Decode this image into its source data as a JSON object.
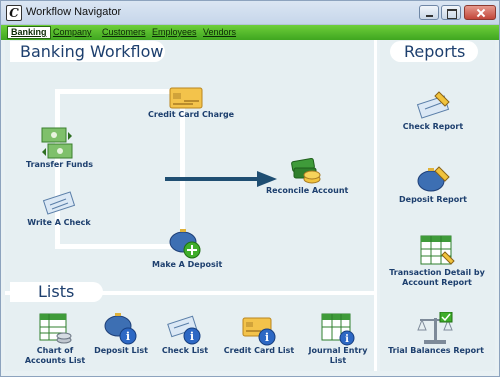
{
  "window": {
    "title": "Workflow Navigator"
  },
  "menu": [
    {
      "label": "Banking",
      "active": true
    },
    {
      "label": "Company"
    },
    {
      "label": "Customers"
    },
    {
      "label": "Employees"
    },
    {
      "label": "Vendors"
    }
  ],
  "sections": {
    "banking": "Banking Workflow",
    "reports": "Reports",
    "lists": "Lists"
  },
  "workflow": {
    "credit_card_charge": "Credit Card Charge",
    "transfer_funds": "Transfer Funds",
    "write_check": "Write A Check",
    "make_deposit": "Make A Deposit",
    "reconcile_account": "Reconcile Account"
  },
  "reports": {
    "check_report": "Check Report",
    "deposit_report": "Deposit Report",
    "transaction_detail_line1": "Transaction Detail by",
    "transaction_detail_line2": "Account Report",
    "trial_balances": "Trial Balances Report"
  },
  "lists": {
    "chart_of_accounts_line1": "Chart of",
    "chart_of_accounts_line2": "Accounts List",
    "deposit_list": "Deposit List",
    "check_list": "Check List",
    "credit_card_list": "Credit Card List",
    "journal_entry_line1": "Journal Entry",
    "journal_entry_line2": "List"
  }
}
